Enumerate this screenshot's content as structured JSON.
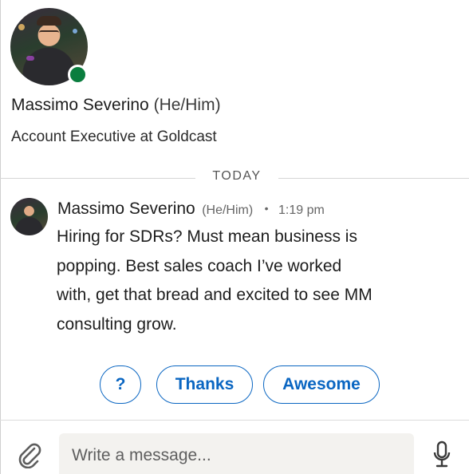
{
  "profile": {
    "name": "Massimo Severino",
    "pronouns": "(He/Him)",
    "headline": "Account Executive at Goldcast",
    "online_status_color": "#0a7d3e"
  },
  "divider": {
    "label": "TODAY"
  },
  "message": {
    "sender": "Massimo Severino",
    "pronouns": "(He/Him)",
    "separator": "•",
    "time": "1:19 pm",
    "lines": [
      "Hiring for SDRs? Must mean business is",
      "popping. Best sales coach I’ve worked",
      "with, get that bread and excited to see MM",
      "consulting grow."
    ]
  },
  "quick_replies": [
    "?",
    "Thanks",
    "Awesome"
  ],
  "composer": {
    "placeholder": "Write a message...",
    "attach_icon": "paperclip-icon",
    "mic_icon": "microphone-icon"
  },
  "colors": {
    "accent": "#0a66c2",
    "input_bg": "#f3f2ef"
  }
}
